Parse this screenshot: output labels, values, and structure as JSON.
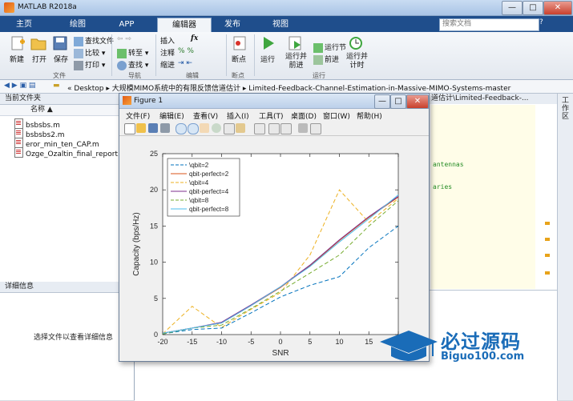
{
  "window": {
    "title": "MATLAB R2018a",
    "minimize": "—",
    "maximize": "□",
    "close": "✕"
  },
  "ribbon_tabs": [
    "主页",
    "绘图",
    "APP",
    "编辑器",
    "发布",
    "视图"
  ],
  "search": {
    "placeholder": "搜索文档"
  },
  "ribbon": {
    "file": {
      "new": "新建",
      "open": "打开",
      "save": "保存",
      "find_files": "查找文件",
      "compare": "比较",
      "print": "打印",
      "section": "文件"
    },
    "navigate": {
      "goto": "转至",
      "find": "查找",
      "section": "导航"
    },
    "edit": {
      "insert": "插入",
      "comment": "注释",
      "indent": "缩进",
      "fx": "fx",
      "section": "编辑"
    },
    "breakpoints": {
      "label": "断点",
      "section": "断点"
    },
    "run": {
      "run": "运行",
      "run_advance": "运行并\n前进",
      "run_section": "运行节",
      "advance": "前进",
      "run_time": "运行并\n计时",
      "section": "运行"
    }
  },
  "address": {
    "crumbs": [
      "«",
      "Desktop",
      "大规模MIMO系统中的有限反馈信道估计",
      "Limited-Feedback-Channel-Estimation-in-Massive-MIMO-Systems-master"
    ]
  },
  "left_panel": {
    "header": "当前文件夹",
    "column": "名称",
    "files": [
      "bsbsbs.m",
      "bsbsbs2.m",
      "eror_min_ten_CAP.m",
      "Ozge_Ozaltin_final_report.pdf"
    ],
    "details_header": "详细信息",
    "details_msg": "选择文件以查看详细信息"
  },
  "editor": {
    "tab_path": "道估计\\Limited-Feedback-...",
    "code_lines": [
      "antennas",
      "aries"
    ]
  },
  "right_rail": {
    "label": "工作区"
  },
  "figure": {
    "title": "Figure 1",
    "menu": [
      "文件(F)",
      "编辑(E)",
      "查看(V)",
      "插入(I)",
      "工具(T)",
      "桌面(D)",
      "窗口(W)",
      "帮助(H)"
    ]
  },
  "watermark": {
    "brand": "必过源码",
    "url": "Biguo100.com"
  },
  "chart_data": {
    "type": "line",
    "xlabel": "SNR",
    "ylabel": "Capacity (bps/Hz)",
    "xlim": [
      -20,
      20
    ],
    "ylim": [
      0,
      25
    ],
    "xticks": [
      -20,
      -15,
      -10,
      -5,
      0,
      5,
      10,
      15,
      20
    ],
    "yticks": [
      0,
      5,
      10,
      15,
      20,
      25
    ],
    "legend_position": "top-left",
    "x": [
      -20,
      -15,
      -10,
      -5,
      0,
      5,
      10,
      15,
      20
    ],
    "series": [
      {
        "name": "\\qbit=2",
        "color": "#0072bd",
        "dash": true,
        "values": [
          0.1,
          0.7,
          0.9,
          3.0,
          5.2,
          6.8,
          8.0,
          12.0,
          15.0
        ]
      },
      {
        "name": "qbit-perfect=2",
        "color": "#d95319",
        "dash": false,
        "values": [
          0.2,
          0.9,
          1.6,
          4.0,
          6.5,
          9.5,
          13.0,
          16.2,
          19.0
        ]
      },
      {
        "name": "\\qbit=4",
        "color": "#edb120",
        "dash": true,
        "values": [
          0.1,
          3.9,
          1.0,
          3.5,
          5.8,
          11.0,
          20.0,
          15.5,
          18.8
        ]
      },
      {
        "name": "qbit-perfect=4",
        "color": "#7e2f8e",
        "dash": false,
        "values": [
          0.2,
          0.9,
          1.7,
          4.1,
          6.6,
          9.6,
          13.1,
          16.3,
          19.1
        ]
      },
      {
        "name": "\\qbit=8",
        "color": "#77ac30",
        "dash": true,
        "values": [
          0.1,
          0.9,
          1.3,
          3.6,
          6.0,
          8.5,
          11.0,
          15.0,
          18.5
        ]
      },
      {
        "name": "qbit-perfect=8",
        "color": "#4dbeee",
        "dash": false,
        "values": [
          0.2,
          0.9,
          1.6,
          4.0,
          6.6,
          9.4,
          12.8,
          16.0,
          19.3
        ]
      }
    ]
  }
}
